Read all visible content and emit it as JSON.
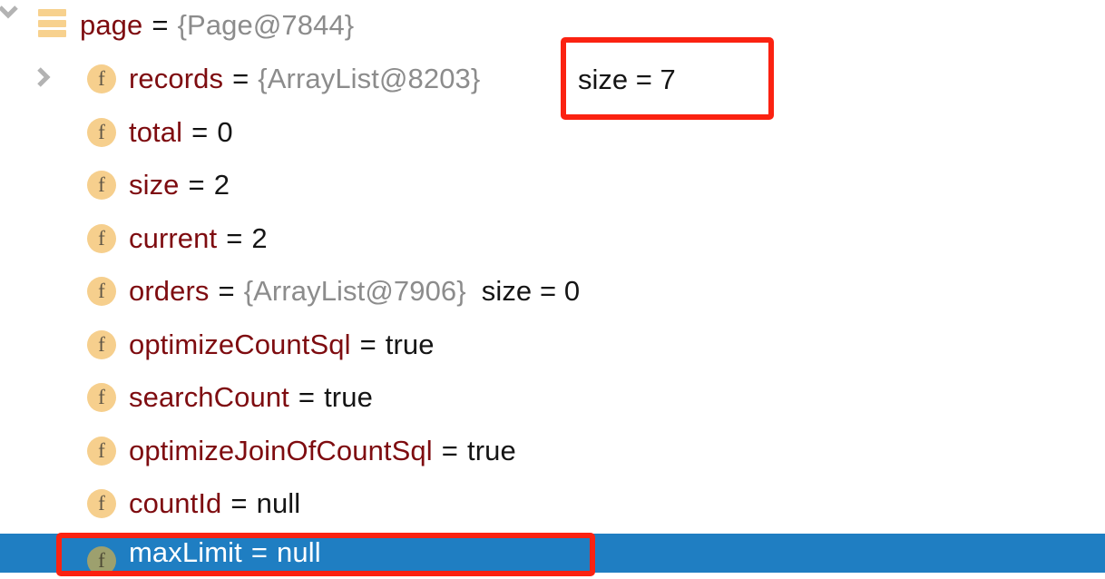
{
  "view": {
    "kind": "debugger-variables-tree",
    "selection_color": "#1F7EC2",
    "annotation_color": "#FB2211",
    "field_name_color": "#7E0C10",
    "reference_color": "#8C8C8C",
    "icon_color": "#F6CF8D"
  },
  "rows": [
    {
      "icon": "list-icon",
      "arrow": "chevron-down-icon",
      "name": "page",
      "eq": "=",
      "ref": "{Page@7844}",
      "value": "",
      "selected": false
    },
    {
      "icon": "field-icon",
      "arrow": "chevron-right-icon",
      "name": "records",
      "eq": "=",
      "ref": "{ArrayList@8203}",
      "value": "",
      "selected": false
    },
    {
      "icon": "field-icon",
      "arrow": "",
      "name": "total",
      "eq": "=",
      "ref": "",
      "value": "0",
      "selected": false
    },
    {
      "icon": "field-icon",
      "arrow": "",
      "name": "size",
      "eq": "=",
      "ref": "",
      "value": "2",
      "selected": false
    },
    {
      "icon": "field-icon",
      "arrow": "",
      "name": "current",
      "eq": "=",
      "ref": "",
      "value": "2",
      "selected": false
    },
    {
      "icon": "field-icon",
      "arrow": "",
      "name": "orders",
      "eq": "=",
      "ref": "{ArrayList@7906}",
      "value": "size = 0",
      "selected": false
    },
    {
      "icon": "field-icon",
      "arrow": "",
      "name": "optimizeCountSql",
      "eq": "=",
      "ref": "",
      "value": "true",
      "selected": false
    },
    {
      "icon": "field-icon",
      "arrow": "",
      "name": "searchCount",
      "eq": "=",
      "ref": "",
      "value": "true",
      "selected": false
    },
    {
      "icon": "field-icon",
      "arrow": "",
      "name": "optimizeJoinOfCountSql",
      "eq": "=",
      "ref": "",
      "value": "true",
      "selected": false
    },
    {
      "icon": "field-icon",
      "arrow": "",
      "name": "countId",
      "eq": "=",
      "ref": "",
      "value": "null",
      "selected": false
    },
    {
      "icon": "field-icon",
      "arrow": "",
      "name": "maxLimit",
      "eq": "=",
      "ref": "",
      "value": "null",
      "selected": true
    }
  ],
  "annotations": {
    "records_size": {
      "text": "size = 7"
    }
  }
}
